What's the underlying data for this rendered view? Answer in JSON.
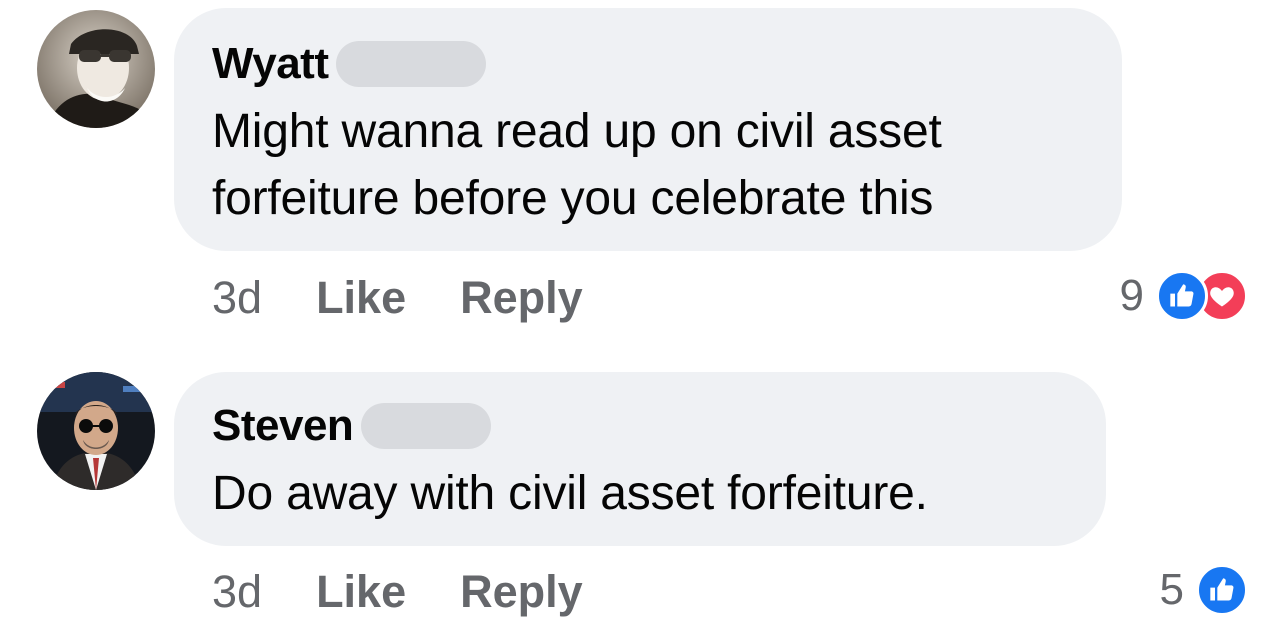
{
  "comments": [
    {
      "author": "Wyatt",
      "text_lines": [
        "Might wanna read up on civil asset",
        "forfeiture before you celebrate this"
      ],
      "timestamp": "3d",
      "like_label": "Like",
      "reply_label": "Reply",
      "reaction_count": "9",
      "reactions": [
        "like-icon",
        "love-icon"
      ]
    },
    {
      "author": "Steven",
      "text_lines": [
        "Do away with civil asset forfeiture."
      ],
      "timestamp": "3d",
      "like_label": "Like",
      "reply_label": "Reply",
      "reaction_count": "5",
      "reactions": [
        "like-icon"
      ]
    }
  ],
  "colors": {
    "bubble_background": "#eff1f4",
    "meta_text": "#65676b",
    "like_blue": "#1877f2",
    "love_red": "#f33e58",
    "redaction": "#d8dade"
  }
}
